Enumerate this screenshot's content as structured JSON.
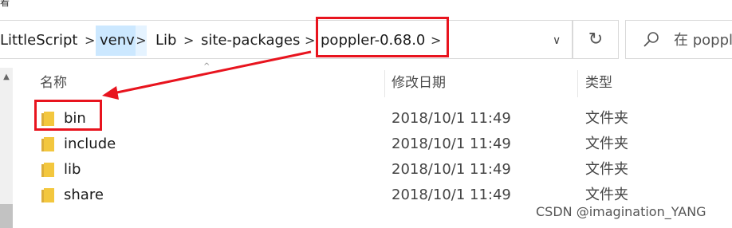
{
  "top_clip_text": "看",
  "breadcrumb": {
    "items": [
      "LittleScript",
      "venv",
      "Lib",
      "site-packages",
      "poppler-0.68.0"
    ],
    "separator": ">"
  },
  "dropdown_glyph": "∨",
  "refresh_glyph": "↻",
  "search": {
    "placeholder": "在 poppl"
  },
  "columns": {
    "name": "名称",
    "date": "修改日期",
    "type": "类型"
  },
  "rows": [
    {
      "name": "bin",
      "date": "2018/10/1 11:49",
      "type": "文件夹"
    },
    {
      "name": "include",
      "date": "2018/10/1 11:49",
      "type": "文件夹"
    },
    {
      "name": "lib",
      "date": "2018/10/1 11:49",
      "type": "文件夹"
    },
    {
      "name": "share",
      "date": "2018/10/1 11:49",
      "type": "文件夹"
    }
  ],
  "watermark": "CSDN @imagination_YANG",
  "colors": {
    "annotation_red": "#e8141e",
    "breadcrumb_highlight": "#cce8ff",
    "folder_yellow": "#f3c73e"
  }
}
